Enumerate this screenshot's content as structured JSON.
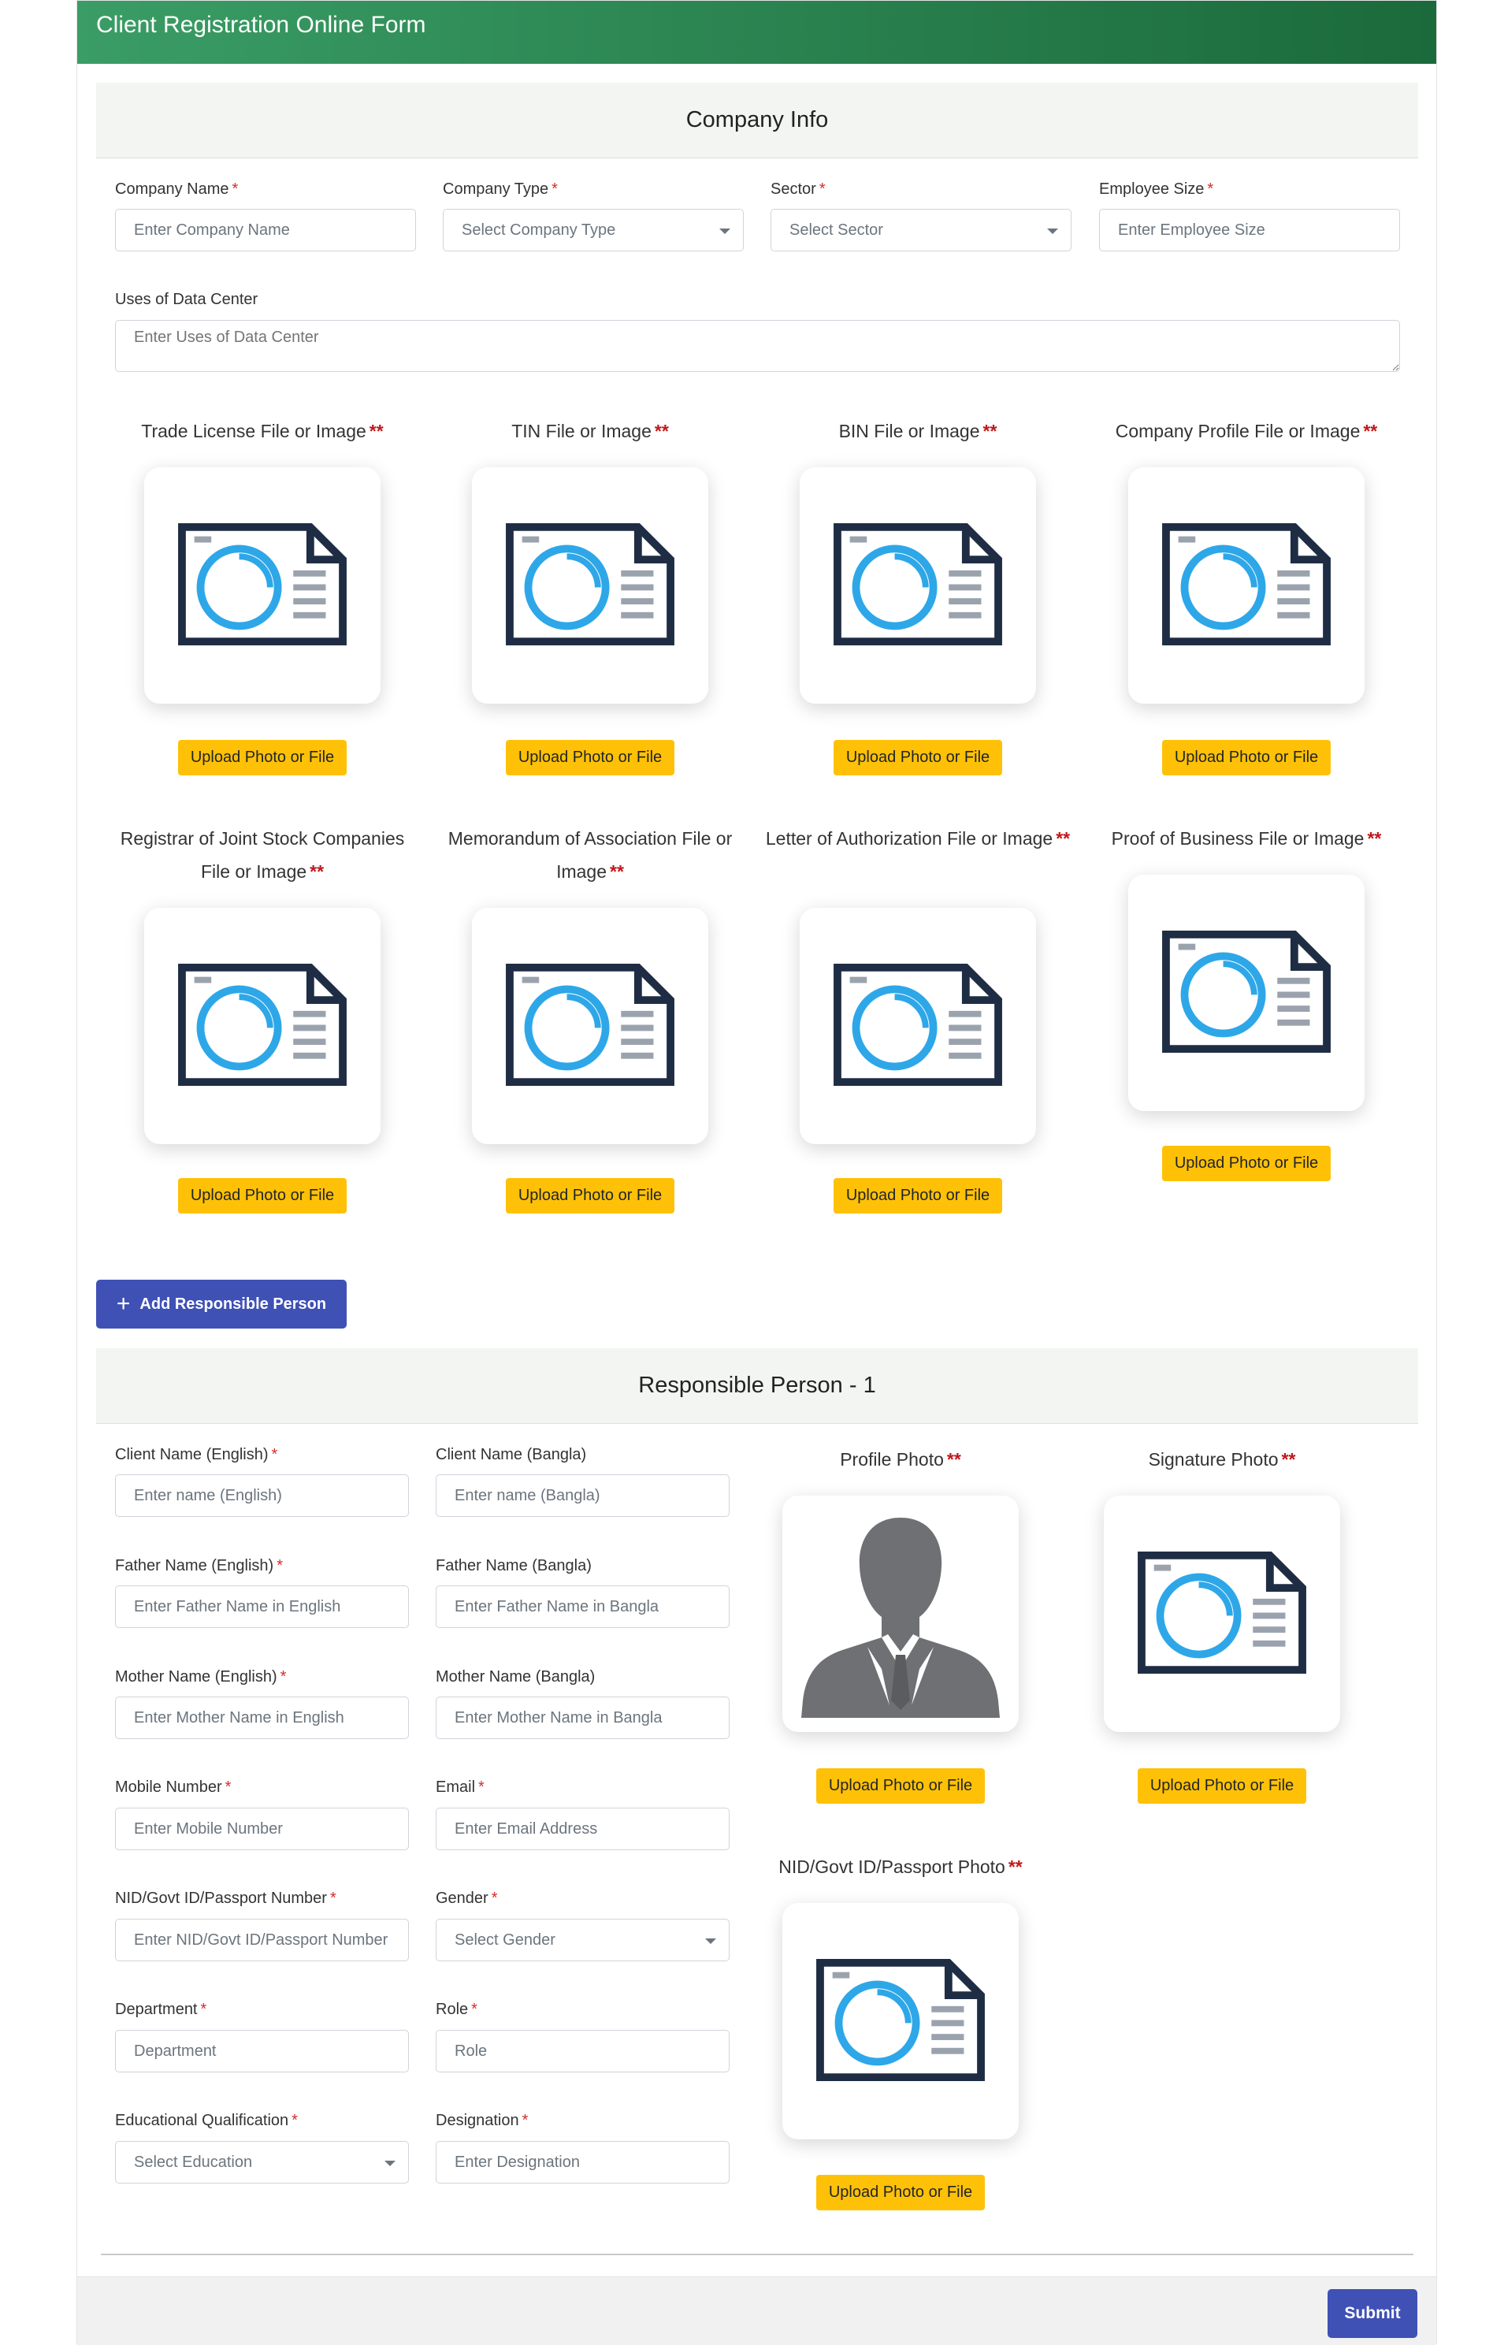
{
  "header": {
    "title": "Client Registration Online Form"
  },
  "company_section": {
    "title": "Company Info",
    "fields": {
      "company_name": {
        "label": "Company Name",
        "req": "*",
        "placeholder": "Enter Company Name"
      },
      "company_type": {
        "label": "Company Type",
        "req": "*",
        "placeholder": "Select Company Type"
      },
      "sector": {
        "label": "Sector",
        "req": "*",
        "placeholder": "Select Sector"
      },
      "employee_size": {
        "label": "Employee Size",
        "req": "*",
        "placeholder": "Enter Employee Size"
      },
      "uses": {
        "label": "Uses of Data Center",
        "placeholder": "Enter Uses of Data Center"
      }
    },
    "documents": [
      {
        "title": "Trade License File or Image",
        "req": "**",
        "button": "Upload Photo or File"
      },
      {
        "title": "TIN File or Image",
        "req": "**",
        "button": "Upload Photo or File"
      },
      {
        "title": "BIN File or Image",
        "req": "**",
        "button": "Upload Photo or File"
      },
      {
        "title": "Company Profile File or Image",
        "req": "**",
        "button": "Upload Photo or File"
      },
      {
        "title": "Registrar of Joint Stock Companies File or Image",
        "req": "**",
        "button": "Upload Photo or File"
      },
      {
        "title": "Memorandum of Association File or Image",
        "req": "**",
        "button": "Upload Photo or File"
      },
      {
        "title": "Letter of Authorization File or Image",
        "req": "**",
        "button": "Upload Photo or File"
      },
      {
        "title": "Proof of Business File or Image",
        "req": "**",
        "button": "Upload Photo or File"
      }
    ]
  },
  "add_person_button": {
    "label": "Add Responsible Person"
  },
  "person_section": {
    "title": "Responsible Person - 1",
    "fields": {
      "client_name_en": {
        "label": "Client Name (English)",
        "req": "*",
        "placeholder": "Enter name (English)"
      },
      "client_name_bn": {
        "label": "Client Name (Bangla)",
        "placeholder": "Enter name (Bangla)"
      },
      "father_en": {
        "label": "Father Name (English)",
        "req": "*",
        "placeholder": "Enter Father Name in English"
      },
      "father_bn": {
        "label": "Father Name (Bangla)",
        "placeholder": "Enter Father Name in Bangla"
      },
      "mother_en": {
        "label": "Mother Name (English)",
        "req": "*",
        "placeholder": "Enter Mother Name in English"
      },
      "mother_bn": {
        "label": "Mother Name (Bangla)",
        "placeholder": "Enter Mother Name in Bangla"
      },
      "mobile": {
        "label": "Mobile Number",
        "req": "*",
        "placeholder": "Enter Mobile Number"
      },
      "email": {
        "label": "Email",
        "req": "*",
        "placeholder": "Enter Email Address"
      },
      "nid": {
        "label": "NID/Govt ID/Passport Number",
        "req": "*",
        "placeholder": "Enter NID/Govt ID/Passport Number"
      },
      "gender": {
        "label": "Gender",
        "req": "*",
        "placeholder": "Select Gender"
      },
      "department": {
        "label": "Department",
        "req": "*",
        "placeholder": "Department"
      },
      "role": {
        "label": "Role",
        "req": "*",
        "placeholder": "Role"
      },
      "education": {
        "label": "Educational Qualification",
        "req": "*",
        "placeholder": "Select Education"
      },
      "designation": {
        "label": "Designation",
        "req": "*",
        "placeholder": "Enter Designation"
      }
    },
    "photos": {
      "profile": {
        "title": "Profile Photo",
        "req": "**",
        "button": "Upload Photo or File"
      },
      "signature": {
        "title": "Signature Photo",
        "req": "**",
        "button": "Upload Photo or File"
      },
      "nid": {
        "title": "NID/Govt ID/Passport Photo",
        "req": "**",
        "button": "Upload Photo or File"
      }
    }
  },
  "footer": {
    "submit_label": "Submit"
  },
  "colors": {
    "header_start": "#3a9d65",
    "header_end": "#1b6a3b",
    "upload": "#ffc107",
    "primary": "#3f51b5",
    "required": "#d62b2b"
  },
  "icons": {
    "document": "photo-document-icon",
    "avatar": "person-silhouette-icon",
    "plus": "plus-icon"
  }
}
